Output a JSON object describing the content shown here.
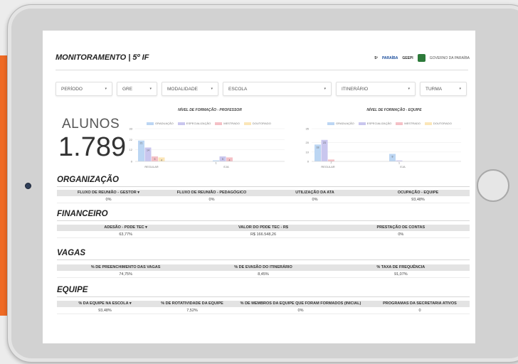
{
  "header": {
    "title": "MONITORAMENTO | 5º IF"
  },
  "logos": {
    "partner1": "5ª",
    "partner2": "PARAÍBA",
    "partner3": "GEEPI",
    "partner4": "GOVERNO DA PARAÍBA"
  },
  "filters": [
    {
      "label": "PERÍODO"
    },
    {
      "label": "GRE"
    },
    {
      "label": "MODALIDADE"
    },
    {
      "label": "ESCOLA"
    },
    {
      "label": "ITINERÁRIO"
    },
    {
      "label": "TURMA"
    }
  ],
  "summary": {
    "label": "ALUNOS",
    "value": "1.789"
  },
  "colors": {
    "graduacao": "#bcd6f3",
    "especializacao": "#c9c6ee",
    "mestrado": "#f4c0c6",
    "doutorado": "#fbe6b8",
    "accent": "#ef6a24"
  },
  "legend": [
    "GRADUAÇÃO",
    "ESPECIALIZAÇÃO",
    "MESTRADO",
    "DOUTORADO"
  ],
  "chart_data": [
    {
      "type": "bar",
      "title": "NÍVEL DE FORMAÇÃO - PROFESSOR",
      "categories": [
        "REGULAR",
        "EJA"
      ],
      "series": [
        {
          "name": "GRADUAÇÃO",
          "values": [
            21,
            1
          ]
        },
        {
          "name": "ESPECIALIZAÇÃO",
          "values": [
            14,
            5
          ]
        },
        {
          "name": "MESTRADO",
          "values": [
            5,
            4
          ]
        },
        {
          "name": "DOUTORADO",
          "values": [
            4,
            0
          ]
        }
      ],
      "yticks": [
        0,
        12,
        22,
        33
      ],
      "ylim": [
        0,
        33
      ]
    },
    {
      "type": "bar",
      "title": "NÍVEL DE FORMAÇÃO - EQUIPE",
      "categories": [
        "REGULAR",
        "EJA"
      ],
      "series": [
        {
          "name": "GRADUAÇÃO",
          "values": [
            18,
            8
          ]
        },
        {
          "name": "ESPECIALIZAÇÃO",
          "values": [
            23,
            1
          ]
        },
        {
          "name": "MESTRADO",
          "values": [
            2,
            0
          ]
        },
        {
          "name": "DOUTORADO",
          "values": [
            0,
            0
          ]
        }
      ],
      "yticks": [
        0,
        10,
        20,
        35
      ],
      "ylim": [
        0,
        35
      ]
    }
  ],
  "sections": [
    {
      "title": "ORGANIZAÇÃO",
      "headers": [
        "FLUXO DE REUNIÃO - GESTOR ▾",
        "FLUXO DE REUNIÃO - PEDAGÓGICO",
        "UTILIZAÇÃO DA ATA",
        "OCUPAÇÃO - EQUIPE"
      ],
      "values": [
        "0%",
        "0%",
        "0%",
        "93,48%"
      ]
    },
    {
      "title": "FINANCEIRO",
      "headers": [
        "ADESÃO - PDDE TEC ▾",
        "VALOR DO PDDE TEC - R$",
        "PRESTAÇÃO DE CONTAS"
      ],
      "values": [
        "63,77%",
        "R$ 166.548,26",
        "0%"
      ]
    },
    {
      "title": "VAGAS",
      "headers": [
        "% DE PREENCHIMENTO DAS VAGAS",
        "% DE EVASÃO DO ITINERÁRIO",
        "% TAXA DE FREQUÊNCIA"
      ],
      "values": [
        "74,75%",
        "8,45%",
        "91,07%"
      ]
    },
    {
      "title": "EQUIPE",
      "headers": [
        "% DA EQUIPE NA ESCOLA ▾",
        "% DE ROTATIVIDADE DA EQUIPE",
        "% DE MEMBROS DA EQUIPE QUE FORAM FORMADOS (INICIAL)",
        "PROGRAMAS DA SECRETARIA ATIVOS"
      ],
      "values": [
        "93,48%",
        "7,52%",
        "0%",
        "0"
      ]
    }
  ]
}
